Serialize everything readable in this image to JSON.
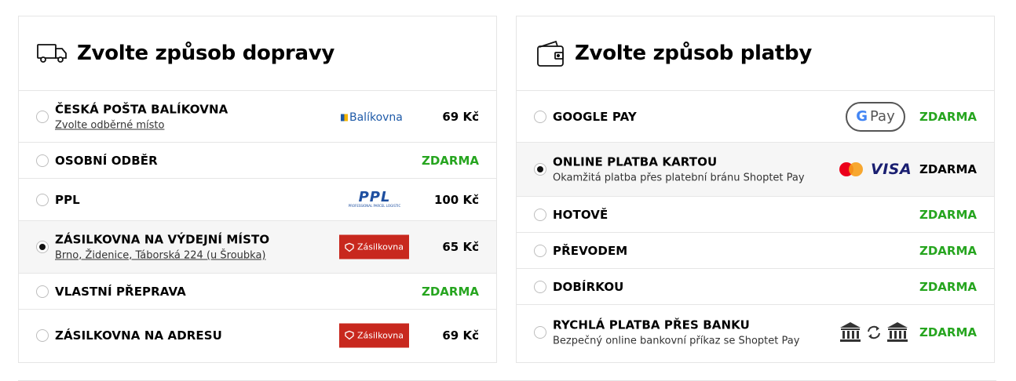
{
  "shipping": {
    "title": "Zvolte způsob dopravy",
    "options": [
      {
        "label": "ČESKÁ POŠTA BALÍKOVNA",
        "sub": "Zvolte odběrné místo",
        "logo_text": "Balíkovna",
        "price": "69 Kč"
      },
      {
        "label": "OSOBNÍ ODBĚR",
        "price": "ZDARMA"
      },
      {
        "label": "PPL",
        "logo_text": "PPL",
        "logo_tag": "PROFESSIONAL PARCEL LOGISTIC",
        "price": "100 Kč"
      },
      {
        "label": "ZÁSILKOVNA NA VÝDEJNÍ MÍSTO",
        "sub": "Brno, Židenice, Táborská 224 (u Šroubka)",
        "logo_text": "Zásilkovna",
        "price": "65 Kč"
      },
      {
        "label": "VLASTNÍ PŘEPRAVA",
        "price": "ZDARMA"
      },
      {
        "label": "ZÁSILKOVNA NA ADRESU",
        "logo_text": "Zásilkovna",
        "price": "69 Kč"
      }
    ],
    "selected_index": 3
  },
  "payment": {
    "title": "Zvolte způsob platby",
    "options": [
      {
        "label": "GOOGLE PAY",
        "logo_text": "Pay",
        "price": "ZDARMA"
      },
      {
        "label": "ONLINE PLATBA KARTOU",
        "sub": "Okamžitá platba přes platební bránu Shoptet Pay",
        "logo_text": "VISA",
        "price": "ZDARMA"
      },
      {
        "label": "HOTOVĚ",
        "price": "ZDARMA"
      },
      {
        "label": "PŘEVODEM",
        "price": "ZDARMA"
      },
      {
        "label": "DOBÍRKOU",
        "price": "ZDARMA"
      },
      {
        "label": "RYCHLÁ PLATBA PŘES BANKU",
        "sub": "Bezpečný online bankovní příkaz se Shoptet Pay",
        "price": "ZDARMA"
      }
    ],
    "selected_index": 1
  },
  "colors": {
    "free": "#26a51f",
    "zasilkovna_red": "#c8281e",
    "visa_blue": "#1a1f71",
    "balikovna_blue": "#1e5aa8"
  },
  "icons": {
    "shipping": "truck-icon",
    "payment": "wallet-icon"
  }
}
